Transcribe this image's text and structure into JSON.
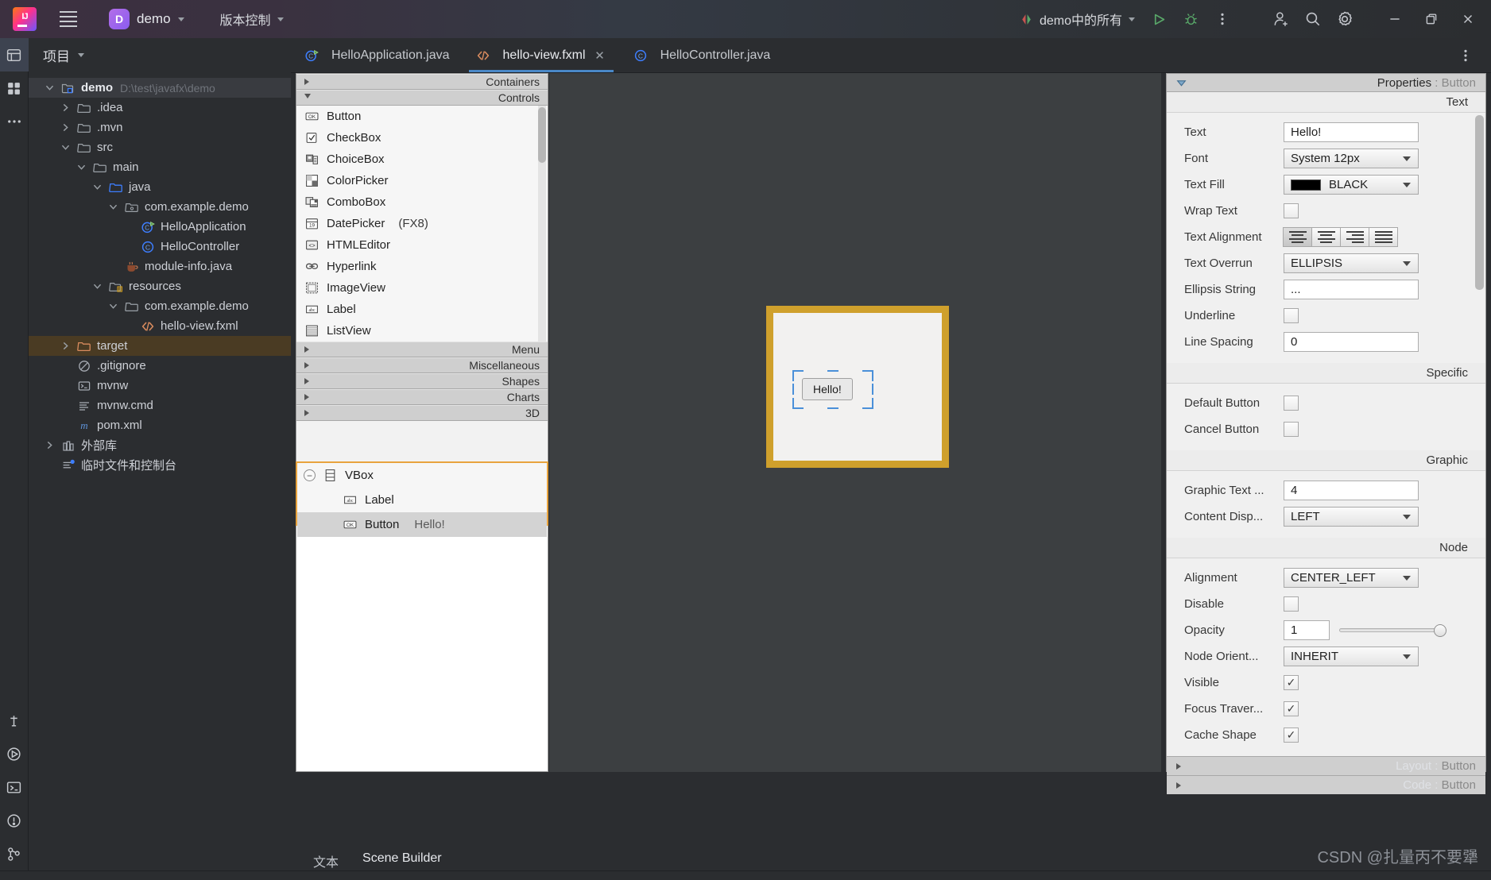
{
  "titlebar": {
    "logo_icon": "intellij-logo-icon",
    "menu_icon": "hamburger-menu-icon",
    "project_badge": "D",
    "project_name": "demo",
    "vcs_label": "版本控制",
    "run_config": "demo中的所有",
    "run_icon": "run-icon",
    "debug_icon": "debug-icon",
    "more_icon": "more-options-icon",
    "account_icon": "add-account-icon",
    "search_icon": "search-icon",
    "settings_icon": "gear-icon",
    "minimize_icon": "minimize-icon",
    "maximize_icon": "maximize-icon",
    "close_icon": "close-icon"
  },
  "toolstrip": {
    "items": [
      {
        "name": "project-tool-icon",
        "selected": true
      },
      {
        "name": "structure-tool-icon",
        "selected": false
      },
      {
        "name": "more-tool-icon",
        "selected": false
      }
    ],
    "bottom_items": [
      {
        "name": "profiler-tool-icon"
      },
      {
        "name": "run-tool-icon"
      },
      {
        "name": "terminal-tool-icon"
      },
      {
        "name": "problems-tool-icon"
      },
      {
        "name": "git-tool-icon"
      }
    ]
  },
  "project": {
    "header": "项目",
    "tree": [
      {
        "indent": 0,
        "arrow": "down",
        "icon": "module-folder-icon",
        "label": "demo",
        "bold": true,
        "path": "D:\\test\\javafx\\demo",
        "selected": true
      },
      {
        "indent": 1,
        "arrow": "right",
        "icon": "folder-icon",
        "label": ".idea"
      },
      {
        "indent": 1,
        "arrow": "right",
        "icon": "folder-icon",
        "label": ".mvn"
      },
      {
        "indent": 1,
        "arrow": "down",
        "icon": "folder-icon",
        "label": "src"
      },
      {
        "indent": 2,
        "arrow": "down",
        "icon": "folder-icon",
        "label": "main"
      },
      {
        "indent": 3,
        "arrow": "down",
        "icon": "source-folder-icon",
        "label": "java"
      },
      {
        "indent": 4,
        "arrow": "down",
        "icon": "package-icon",
        "label": "com.example.demo"
      },
      {
        "indent": 5,
        "arrow": "none",
        "icon": "java-runnable-class-icon",
        "label": "HelloApplication"
      },
      {
        "indent": 5,
        "arrow": "none",
        "icon": "java-class-icon",
        "label": "HelloController"
      },
      {
        "indent": 4,
        "arrow": "none",
        "icon": "java-file-icon",
        "label": "module-info.java"
      },
      {
        "indent": 3,
        "arrow": "down",
        "icon": "resources-folder-icon",
        "label": "resources"
      },
      {
        "indent": 4,
        "arrow": "down",
        "icon": "folder-icon",
        "label": "com.example.demo"
      },
      {
        "indent": 5,
        "arrow": "none",
        "icon": "fxml-file-icon",
        "label": "hello-view.fxml"
      },
      {
        "indent": 1,
        "arrow": "right",
        "icon": "target-folder-icon",
        "label": "target",
        "targetSelected": true
      },
      {
        "indent": 1,
        "arrow": "none",
        "icon": "gitignore-icon",
        "label": ".gitignore"
      },
      {
        "indent": 1,
        "arrow": "none",
        "icon": "shell-script-icon",
        "label": "mvnw"
      },
      {
        "indent": 1,
        "arrow": "none",
        "icon": "cmd-file-icon",
        "label": "mvnw.cmd"
      },
      {
        "indent": 1,
        "arrow": "none",
        "icon": "maven-pom-icon",
        "label": "pom.xml"
      },
      {
        "indent": 0,
        "arrow": "right",
        "icon": "external-libraries-icon",
        "label": "外部库"
      },
      {
        "indent": 0,
        "arrow": "none",
        "icon": "scratches-icon",
        "label": "临时文件和控制台"
      }
    ]
  },
  "editor_tabs": {
    "tabs": [
      {
        "label": "HelloApplication.java",
        "icon": "java-runnable-class-icon",
        "active": false,
        "closable": false
      },
      {
        "label": "hello-view.fxml",
        "icon": "fxml-file-icon",
        "active": true,
        "closable": true,
        "close_icon": "close-icon"
      },
      {
        "label": "HelloController.java",
        "icon": "java-class-icon",
        "active": false,
        "closable": false
      }
    ],
    "more_icon": "more-options-icon"
  },
  "scene_builder": {
    "library": {
      "sections": [
        {
          "label": "Containers",
          "open": false
        },
        {
          "label": "Controls",
          "open": true
        }
      ],
      "controls": [
        {
          "label": "Button",
          "icon": "button-widget-icon"
        },
        {
          "label": "CheckBox",
          "icon": "checkbox-widget-icon"
        },
        {
          "label": "ChoiceBox",
          "icon": "choicebox-widget-icon"
        },
        {
          "label": "ColorPicker",
          "icon": "colorpicker-widget-icon"
        },
        {
          "label": "ComboBox",
          "icon": "combobox-widget-icon"
        },
        {
          "label": "DatePicker",
          "suffix": "(FX8)",
          "icon": "datepicker-widget-icon"
        },
        {
          "label": "HTMLEditor",
          "icon": "htmleditor-widget-icon"
        },
        {
          "label": "Hyperlink",
          "icon": "hyperlink-widget-icon"
        },
        {
          "label": "ImageView",
          "icon": "imageview-widget-icon"
        },
        {
          "label": "Label",
          "icon": "label-widget-icon"
        },
        {
          "label": "ListView",
          "icon": "listview-widget-icon"
        }
      ],
      "more_sections": [
        {
          "label": "Menu",
          "open": false
        },
        {
          "label": "Miscellaneous",
          "open": false
        },
        {
          "label": "Shapes",
          "open": false
        },
        {
          "label": "Charts",
          "open": false
        },
        {
          "label": "3D",
          "open": false
        }
      ]
    },
    "hierarchy": [
      {
        "label": "VBox",
        "icon": "vbox-node-icon",
        "value": "",
        "selected": false,
        "collapse_icon": "collapse-icon"
      },
      {
        "label": "Label",
        "icon": "label-widget-icon",
        "value": "",
        "selected": false
      },
      {
        "label": "Button",
        "icon": "button-widget-icon",
        "value": "Hello!",
        "selected": true
      }
    ],
    "canvas": {
      "button_label": "Hello!",
      "accent_color": "#cfa02c",
      "selection_color": "#4a90d9"
    },
    "properties": {
      "header_title": "Properties",
      "header_target": "Button",
      "groups": [
        {
          "band": "Text",
          "rows": [
            {
              "label": "Text",
              "type": "field",
              "value": "Hello!"
            },
            {
              "label": "Font",
              "type": "combo",
              "value": "System 12px"
            },
            {
              "label": "Text Fill",
              "type": "color",
              "value": "BLACK",
              "color": "#000000"
            },
            {
              "label": "Wrap Text",
              "type": "check",
              "value": false
            },
            {
              "label": "Text Alignment",
              "type": "align",
              "value": 0
            },
            {
              "label": "Text Overrun",
              "type": "combo",
              "value": "ELLIPSIS"
            },
            {
              "label": "Ellipsis String",
              "type": "field",
              "value": "..."
            },
            {
              "label": "Underline",
              "type": "check",
              "value": false
            },
            {
              "label": "Line Spacing",
              "type": "field",
              "value": "0"
            }
          ]
        },
        {
          "band": "Specific",
          "rows": [
            {
              "label": "Default Button",
              "type": "check",
              "value": false
            },
            {
              "label": "Cancel Button",
              "type": "check",
              "value": false
            }
          ]
        },
        {
          "band": "Graphic",
          "rows": [
            {
              "label": "Graphic Text ...",
              "type": "field",
              "value": "4"
            },
            {
              "label": "Content Disp...",
              "type": "combo",
              "value": "LEFT"
            }
          ]
        },
        {
          "band": "Node",
          "rows": [
            {
              "label": "Alignment",
              "type": "combo",
              "value": "CENTER_LEFT"
            },
            {
              "label": "Disable",
              "type": "check",
              "value": false
            },
            {
              "label": "Opacity",
              "type": "slider",
              "value": "1"
            },
            {
              "label": "Node Orient...",
              "type": "combo",
              "value": "INHERIT"
            },
            {
              "label": "Visible",
              "type": "check",
              "value": true
            },
            {
              "label": "Focus Traver...",
              "type": "check",
              "value": true
            },
            {
              "label": "Cache Shape",
              "type": "check",
              "value": true
            }
          ]
        }
      ],
      "footers": [
        {
          "title": "Layout",
          "target": "Button"
        },
        {
          "title": "Code",
          "target": "Button"
        }
      ]
    }
  },
  "bottom": {
    "tabs": [
      {
        "label": "文本",
        "active": false
      },
      {
        "label": "Scene Builder",
        "active": true
      }
    ]
  },
  "watermark": "CSDN @扎量丙不要犟"
}
